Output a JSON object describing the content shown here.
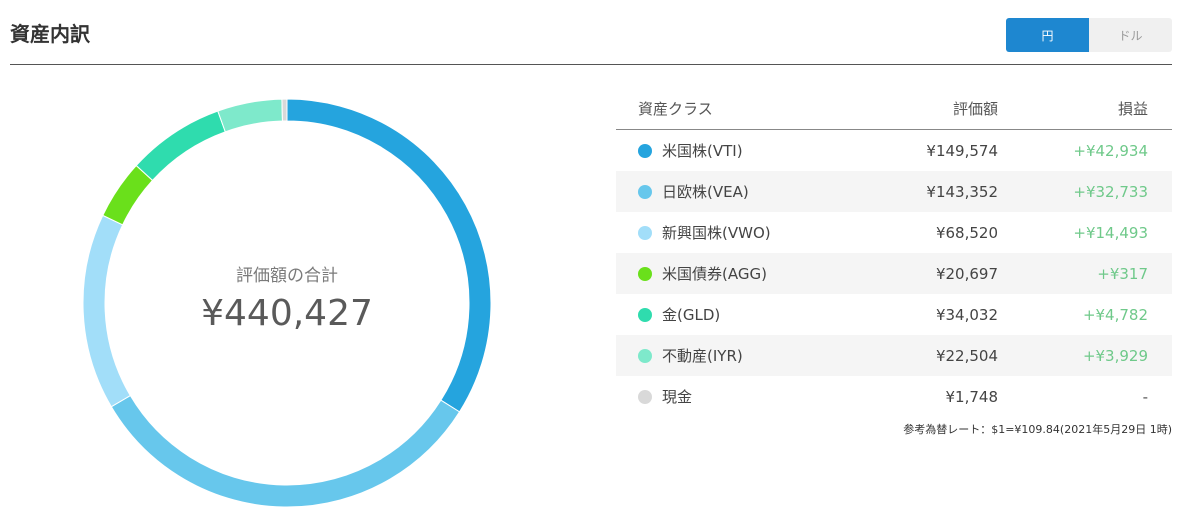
{
  "header": {
    "title": "資産内訳",
    "currency_toggle": {
      "options": [
        "円",
        "ドル"
      ],
      "selected": "円"
    }
  },
  "summary": {
    "center_label": "評価額の合計",
    "total": "¥440,427"
  },
  "table": {
    "headers": {
      "asset_class": "資産クラス",
      "valuation": "評価額",
      "pl": "損益"
    },
    "rows": [
      {
        "name": "米国株(VTI)",
        "valuation": "¥149,574",
        "pl": "+¥42,934",
        "color": "#25a4de",
        "amount": 149574
      },
      {
        "name": "日欧株(VEA)",
        "valuation": "¥143,352",
        "pl": "+¥32,733",
        "color": "#67c7ec",
        "amount": 143352
      },
      {
        "name": "新興国株(VWO)",
        "valuation": "¥68,520",
        "pl": "+¥14,493",
        "color": "#a2def9",
        "amount": 68520
      },
      {
        "name": "米国債券(AGG)",
        "valuation": "¥20,697",
        "pl": "+¥317",
        "color": "#6ae01b",
        "amount": 20697
      },
      {
        "name": "金(GLD)",
        "valuation": "¥34,032",
        "pl": "+¥4,782",
        "color": "#2fdcae",
        "amount": 34032
      },
      {
        "name": "不動産(IYR)",
        "valuation": "¥22,504",
        "pl": "+¥3,929",
        "color": "#7ee9cb",
        "amount": 22504
      },
      {
        "name": "現金",
        "valuation": "¥1,748",
        "pl": "-",
        "color": "#d9d9d9",
        "amount": 1748
      }
    ]
  },
  "note": "参考為替レート：$1=¥109.84(2021年5月29日 1時)"
}
